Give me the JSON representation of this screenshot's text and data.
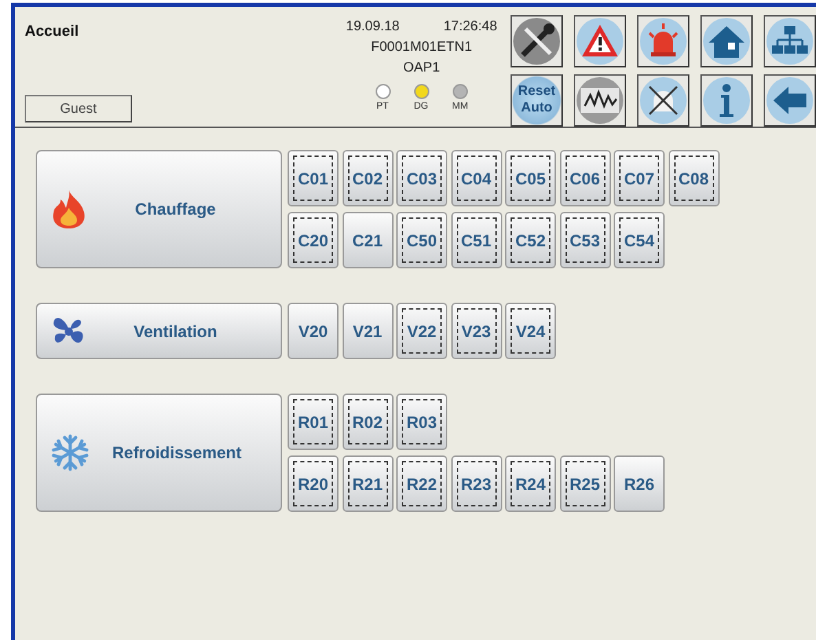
{
  "header": {
    "title": "Accueil",
    "user": "Guest",
    "date": "19.09.18",
    "time": "17:26:48",
    "station": "F0001M01ETN1",
    "unit": "OAP1",
    "lights": [
      {
        "label": "PT",
        "color": "#ffffff"
      },
      {
        "label": "DG",
        "color": "#f2d81c"
      },
      {
        "label": "MM",
        "color": "#b4b4b4"
      }
    ],
    "reset_button": "Reset Auto"
  },
  "groups": [
    {
      "kind": "heating",
      "label": "Chauffage",
      "rows": [
        [
          {
            "label": "C01",
            "dashed": true
          },
          {
            "label": "C02",
            "dashed": true
          },
          {
            "label": "C03",
            "dashed": true
          },
          {
            "label": "C04",
            "dashed": true
          },
          {
            "label": "C05",
            "dashed": true
          },
          {
            "label": "C06",
            "dashed": true
          },
          {
            "label": "C07",
            "dashed": true
          },
          {
            "label": "C08",
            "dashed": true
          }
        ],
        [
          {
            "label": "C20",
            "dashed": true
          },
          {
            "label": "C21",
            "dashed": false
          },
          {
            "label": "C50",
            "dashed": true
          },
          {
            "label": "C51",
            "dashed": true
          },
          {
            "label": "C52",
            "dashed": true
          },
          {
            "label": "C53",
            "dashed": true
          },
          {
            "label": "C54",
            "dashed": true
          }
        ]
      ]
    },
    {
      "kind": "ventilation",
      "label": "Ventilation",
      "rows": [
        [
          {
            "label": "V20",
            "dashed": false
          },
          {
            "label": "V21",
            "dashed": false
          },
          {
            "label": "V22",
            "dashed": true
          },
          {
            "label": "V23",
            "dashed": true
          },
          {
            "label": "V24",
            "dashed": true
          }
        ]
      ]
    },
    {
      "kind": "cooling",
      "label": "Refroidissement",
      "rows": [
        [
          {
            "label": "R01",
            "dashed": true
          },
          {
            "label": "R02",
            "dashed": true
          },
          {
            "label": "R03",
            "dashed": true
          }
        ],
        [
          {
            "label": "R20",
            "dashed": true
          },
          {
            "label": "R21",
            "dashed": true
          },
          {
            "label": "R22",
            "dashed": true
          },
          {
            "label": "R23",
            "dashed": true
          },
          {
            "label": "R24",
            "dashed": true
          },
          {
            "label": "R25",
            "dashed": true
          },
          {
            "label": "R26",
            "dashed": false
          }
        ]
      ]
    }
  ]
}
